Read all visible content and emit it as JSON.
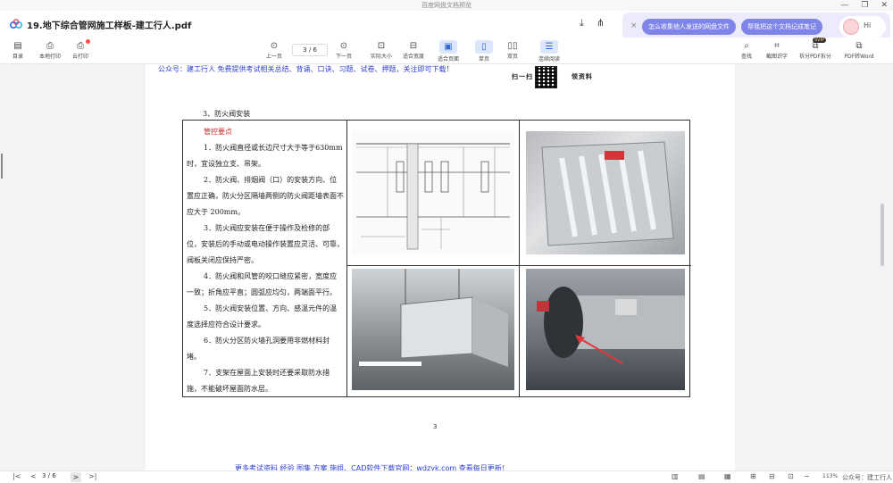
{
  "window": {
    "title": "百度网盘文档预览",
    "min": "—",
    "restore": "❐",
    "close": "✕"
  },
  "tab": {
    "doc_title": "19.地下综合管网施工样板-建工行人.pdf",
    "download_icon": "download-icon",
    "share_icon": "share-icon"
  },
  "ai_bar": {
    "close": "×",
    "pill1": "怎么收集他人发送的网盘文件",
    "pill2": "帮我把这个文档记成笔记",
    "hi": "Hi"
  },
  "toolbar": {
    "toc": "目录",
    "local_print": "本地打印",
    "cloud_print": "云打印",
    "prev": "上一页",
    "page": "3 / 6",
    "next": "下一页",
    "actual": "实际大小",
    "fit_width": "适合宽度",
    "fit_page": "适合页面",
    "single": "单页",
    "double": "双页",
    "continuous": "连续阅读",
    "search": "查找",
    "ocr": "截图识字",
    "split": "拆分PDF拆分",
    "svip": "SVIP",
    "to_word": "PDF转Word"
  },
  "page": {
    "header_blue": "公众号：建工行人 免费提供考试相关总结、背诵、口诀、习题、试卷、押题，关注即可下载！",
    "header_black_left": "扫一扫",
    "header_black_right": "领资料",
    "section": "3、防火阀安装",
    "key_points": "管控要点",
    "items": [
      "1．防火阀直径或长边尺寸大于等于630mm时，宜设独立支、吊架。",
      "2．防火阀、排烟阀（口）的安装方向、位置应正确，防火分区隔墙两侧的防火阀距墙表面不应大于 200mm。",
      "3．防火阀应安装在便于操作及检修的部位，安装后的手动或电动操作装置应灵活、可靠，阀板关闭应保持严密。",
      "4．防火阀和风管的咬口缝应紧密，宽度应一致；折角应平直；圆弧应均匀，两端面平行。",
      "5．防火阀安装位置、方向、感温元件的温度选择应符合设计要求。",
      "6．防火分区防火墙孔洞要用非燃材料封堵。",
      "7．支架在屋面上安装时还要采取防水措施，不能破坏屋面防水层。"
    ],
    "page_number": "3",
    "footer_blue": "更多考试资料 经验 图集 方案 施组、CAD软件下载官网：wdzyk.com 查看每日更新！"
  },
  "status": {
    "first": "|<",
    "prev": "<",
    "page": "3 / 6",
    "next": ">",
    "last": ">|",
    "zoom": "113%",
    "watermark": "公众号：建工行人"
  },
  "colors": {
    "blue_text": "#2e3fd0",
    "red_text": "#d42a2a",
    "accent": "#2f66d6",
    "ai_pill": "#7e84e8"
  }
}
